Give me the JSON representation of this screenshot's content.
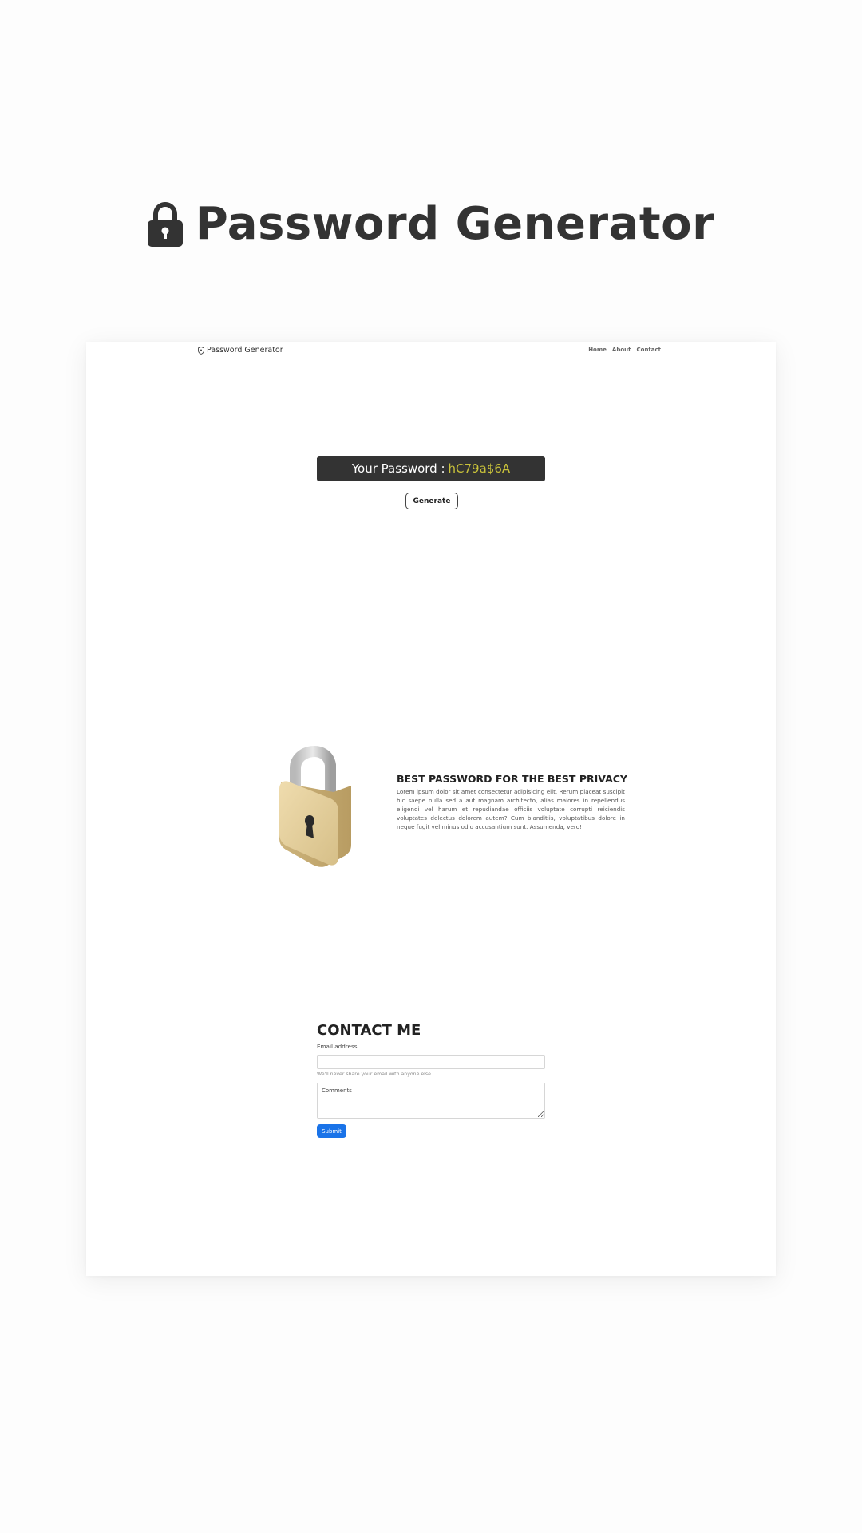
{
  "hero": {
    "icon": "lock-icon",
    "title": "Password Generator"
  },
  "nav": {
    "brand_icon": "shield-icon",
    "brand": "Password Generator",
    "links": [
      "Home",
      "About",
      "Contact"
    ]
  },
  "generator": {
    "label": "Your Password :",
    "password": "hC79a$6A",
    "password_color": "#c9c23a",
    "button": "Generate"
  },
  "about": {
    "illustration": "padlock-illustration",
    "title": "BEST PASSWORD FOR THE BEST PRIVACY",
    "text": "Lorem ipsum dolor sit amet consectetur adipisicing elit. Rerum placeat suscipit hic saepe nulla sed a aut magnam architecto, alias maiores in repellendus eligendi vel harum et repudiandae officiis voluptate corrupti reiciendis voluptates delectus dolorem autem? Cum blanditiis, voluptatibus dolore in neque fugit vel minus odio accusantium sunt. Assumenda, vero!"
  },
  "contact": {
    "title": "CONTACT ME",
    "email_label": "Email address",
    "email_value": "",
    "email_help": "We'll never share your email with anyone else.",
    "comments_placeholder": "Comments",
    "submit": "Submit",
    "submit_color": "#1a73e8"
  }
}
